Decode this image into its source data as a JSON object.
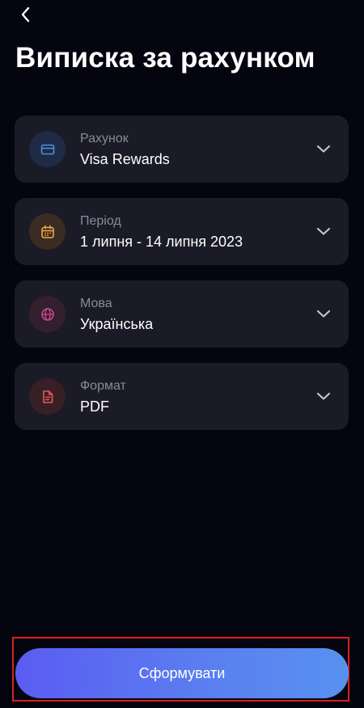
{
  "header": {
    "back_icon": "chevron-left-icon",
    "title": "Виписка за рахунком"
  },
  "fields": [
    {
      "label": "Рахунок",
      "value": "Visa Rewards",
      "icon": "card-icon",
      "icon_color": "#4a90e2",
      "icon_bg": "#1f2a44"
    },
    {
      "label": "Період",
      "value": "1 липня - 14 липня 2023",
      "icon": "calendar-icon",
      "icon_color": "#f3a84a",
      "icon_bg": "#3a2c22"
    },
    {
      "label": "Мова",
      "value": "Українська",
      "icon": "globe-icon",
      "icon_color": "#d2479a",
      "icon_bg": "#331f2e"
    },
    {
      "label": "Формат",
      "value": "PDF",
      "icon": "document-icon",
      "icon_color": "#e05a5a",
      "icon_bg": "#381f26"
    }
  ],
  "action": {
    "submit_label": "Сформувати"
  },
  "colors": {
    "background": "#05050f",
    "card": "#1b1b27",
    "button_gradient_start": "#5b5cf2",
    "button_gradient_end": "#5891f0",
    "highlight": "#e01e1e"
  }
}
